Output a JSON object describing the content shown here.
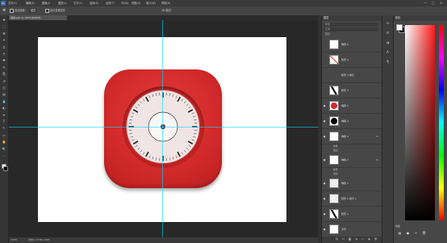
{
  "app": {
    "logo": "Ps"
  },
  "menubar": {
    "items": [
      "文件(F)",
      "编辑(E)",
      "图像(I)",
      "图层(L)",
      "文字(Y)",
      "选择(S)",
      "滤镜(T)",
      "3D(D)",
      "视图(V)",
      "窗口(W)",
      "帮助(H)"
    ],
    "window_buttons": [
      "—",
      "□",
      "✕"
    ]
  },
  "optionsbar": {
    "tool_icon": "move-icon",
    "auto_select_label": "自动选择:",
    "auto_select_value": "图层",
    "show_transform_label": "显示变换控件",
    "mode_3d_label": "3D 模式:"
  },
  "document": {
    "tab_title": "闹钟.psd @ 100%(RGB/8)",
    "zoom": "100%",
    "doc_size": "文档:1.37M/1.49M"
  },
  "clock": {
    "face_color": "#f0e4e4",
    "icon_color": "#d22a2a"
  },
  "toolbar": {
    "tools": [
      "move-icon",
      "marquee-icon",
      "lasso-icon",
      "magic-wand-icon",
      "crop-icon",
      "eyedropper-icon",
      "healing-icon",
      "brush-icon",
      "stamp-icon",
      "history-brush-icon",
      "eraser-icon",
      "gradient-icon",
      "blur-icon",
      "dodge-icon",
      "pen-icon",
      "type-icon",
      "path-select-icon",
      "shape-icon",
      "hand-icon",
      "zoom-icon",
      "more-icon"
    ],
    "tool_glyphs": [
      "✥",
      "⬚",
      "ᘐ",
      "✦",
      "⌗",
      "⚲",
      "✚",
      "✎",
      "⎘",
      "↺",
      "◫",
      "▤",
      "💧",
      "◐",
      "✒",
      "T",
      "↖",
      "▭",
      "✋",
      "🔍",
      "…"
    ]
  },
  "layers_panel": {
    "title": "图层",
    "search_placeholder": "类型",
    "blend_mode": "正常",
    "lock_label": "锁定:",
    "layers": [
      {
        "name": "椭圆 6",
        "visible": false,
        "thumb": "white",
        "fx": ""
      },
      {
        "name": "矩形 4",
        "visible": false,
        "thumb": "diag-red",
        "fx": ""
      },
      {
        "name": "矩形 3 拷贝",
        "visible": false,
        "thumb": "none",
        "fx": ""
      },
      {
        "name": "矩形 3",
        "visible": false,
        "thumb": "diag-black",
        "fx": ""
      },
      {
        "name": "椭圆 5",
        "visible": true,
        "thumb": "red-dot",
        "fx": ""
      },
      {
        "name": "椭圆 4",
        "visible": true,
        "thumb": "black-dot",
        "fx": ""
      },
      {
        "name": "椭圆 3",
        "visible": true,
        "thumb": "white",
        "fx": "fx"
      },
      {
        "name": "椭圆 2",
        "visible": true,
        "thumb": "white",
        "fx": "fx"
      },
      {
        "name": "椭圆 1",
        "visible": true,
        "thumb": "checker",
        "fx": ""
      },
      {
        "name": "矩形 2 拷贝 2",
        "visible": true,
        "thumb": "checker",
        "fx": ""
      },
      {
        "name": "矩形 1",
        "visible": true,
        "thumb": "diag-black",
        "fx": ""
      },
      {
        "name": "背景",
        "visible": true,
        "thumb": "white",
        "fx": ""
      }
    ],
    "sub_effects": [
      {
        "after": 6,
        "items": [
          "效果",
          "描边"
        ]
      },
      {
        "after": 7,
        "items": [
          "效果",
          "描边"
        ]
      }
    ],
    "footer_buttons": [
      "link-icon",
      "fx-icon",
      "mask-icon",
      "adjust-icon",
      "folder-icon",
      "new-layer-icon",
      "trash-icon"
    ],
    "footer_glyphs": [
      "⛓",
      "fx",
      "◙",
      "◑",
      "▭",
      "▣",
      "🗑"
    ]
  },
  "color_panel": {
    "title": "颜色",
    "swatches_label": "色板",
    "swatch_icons": [
      "grid-icon",
      "circle-icon",
      "plus-icon",
      "trash-icon"
    ],
    "swatch_glyphs": [
      "▦",
      "●",
      "+",
      "🗑"
    ],
    "hue": "#ff1a1a"
  },
  "side_icons": {
    "names": [
      "history-icon",
      "properties-icon",
      "adjustments-icon",
      "character-icon",
      "paragraph-icon"
    ],
    "glyphs": [
      "⟲",
      "☰",
      "◑",
      "A",
      "¶"
    ]
  }
}
